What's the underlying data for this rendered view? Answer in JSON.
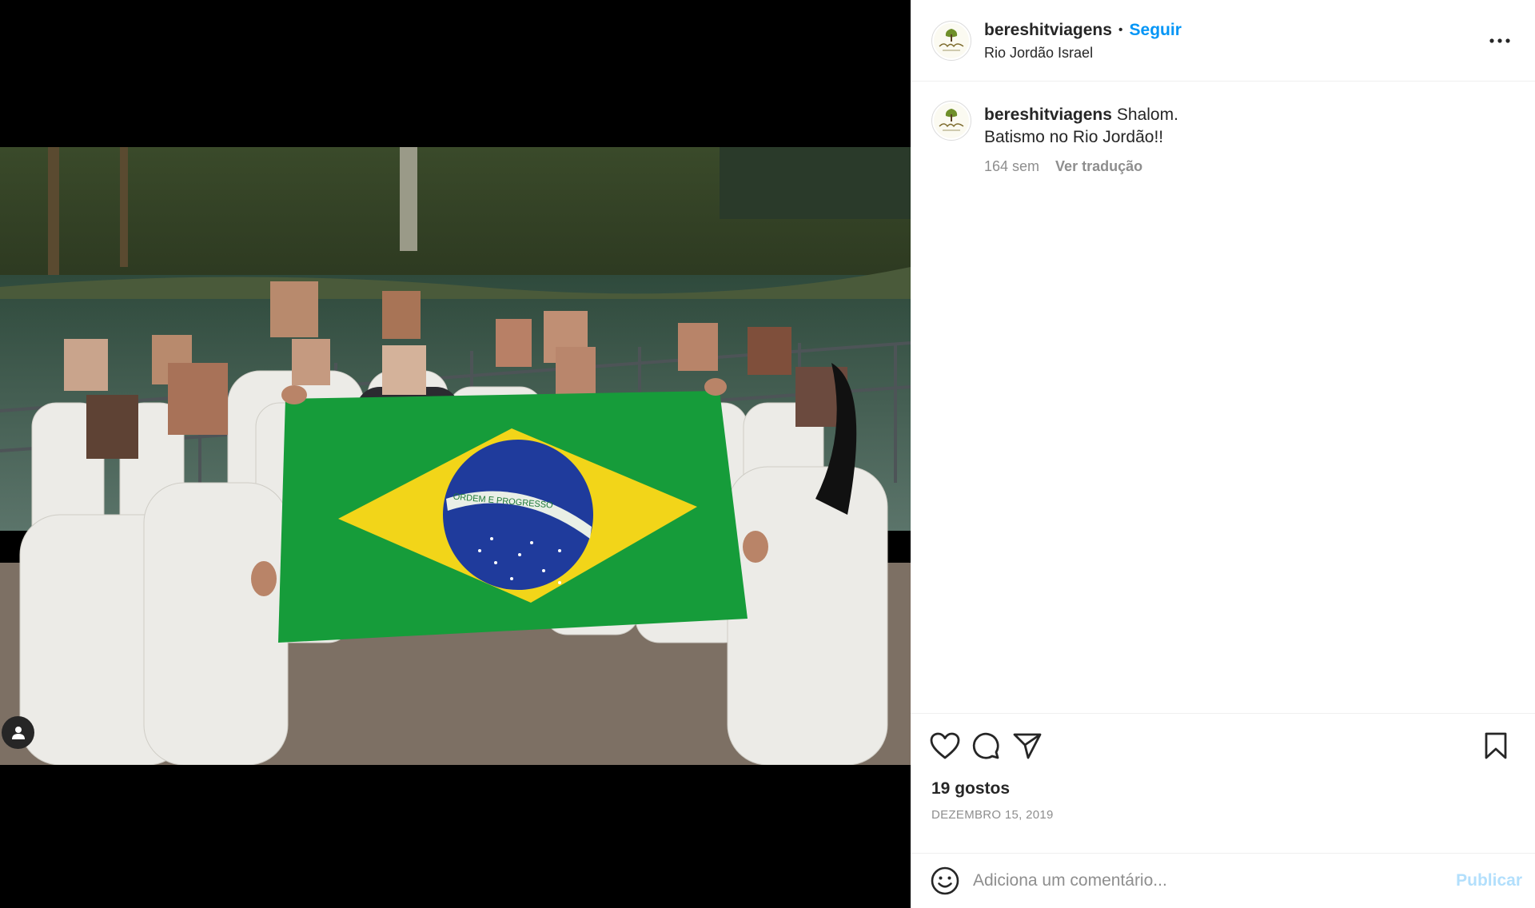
{
  "post": {
    "username": "bereshitviagens",
    "separator": "•",
    "follow_label": "Seguir",
    "location": "Rio Jordão Israel",
    "more_icon": "more-horizontal-icon",
    "avatar_alt": "Bereshit logo"
  },
  "caption": {
    "username": "bereshitviagens",
    "line1": "Shalom.",
    "line2": "Batismo no Rio Jordão!!",
    "age": "164 sem",
    "translate_label": "Ver tradução"
  },
  "media": {
    "flag_motto": "ORDEM E PROGRESSO",
    "tag_icon": "person-tag-icon"
  },
  "actions": {
    "like_icon": "heart-icon",
    "comment_icon": "comment-icon",
    "share_icon": "share-icon",
    "save_icon": "bookmark-icon",
    "likes": "19 gostos",
    "date": "DEZEMBRO 15, 2019"
  },
  "comment": {
    "emoji_icon": "emoji-icon",
    "placeholder": "Adiciona um comentário...",
    "publish_label": "Publicar"
  },
  "colors": {
    "accent": "#0095f6",
    "publish_disabled": "#b2dffc",
    "muted": "#8e8e8e",
    "flag_green": "#169c3a",
    "flag_yellow": "#f2d519",
    "flag_blue": "#1f3b9c"
  }
}
